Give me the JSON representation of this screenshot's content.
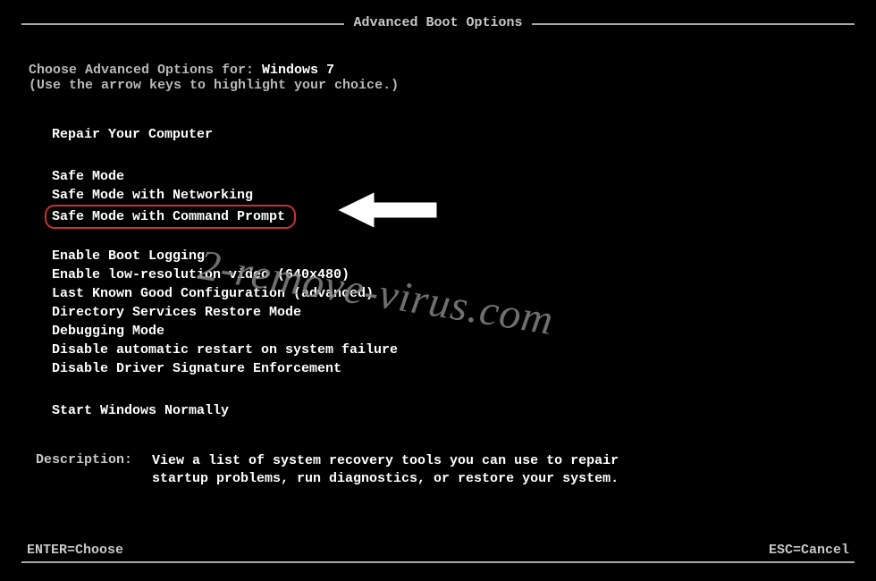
{
  "title": "Advanced Boot Options",
  "intro": {
    "prefix": "Choose Advanced Options for: ",
    "os": "Windows 7",
    "hint": "(Use the arrow keys to highlight your choice.)"
  },
  "groups": {
    "repair": "Repair Your Computer",
    "safe": [
      "Safe Mode",
      "Safe Mode with Networking",
      "Safe Mode with Command Prompt"
    ],
    "advanced": [
      "Enable Boot Logging",
      "Enable low-resolution video (640x480)",
      "Last Known Good Configuration (advanced)",
      "Directory Services Restore Mode",
      "Debugging Mode",
      "Disable automatic restart on system failure",
      "Disable Driver Signature Enforcement"
    ],
    "normal": "Start Windows Normally"
  },
  "highlighted_item": "Safe Mode with Command Prompt",
  "description": {
    "label": "Description:",
    "text": "View a list of system recovery tools you can use to repair startup problems, run diagnostics, or restore your system."
  },
  "footer": {
    "enter": "ENTER=Choose",
    "esc": "ESC=Cancel"
  },
  "watermark": "2-remove-virus.com"
}
